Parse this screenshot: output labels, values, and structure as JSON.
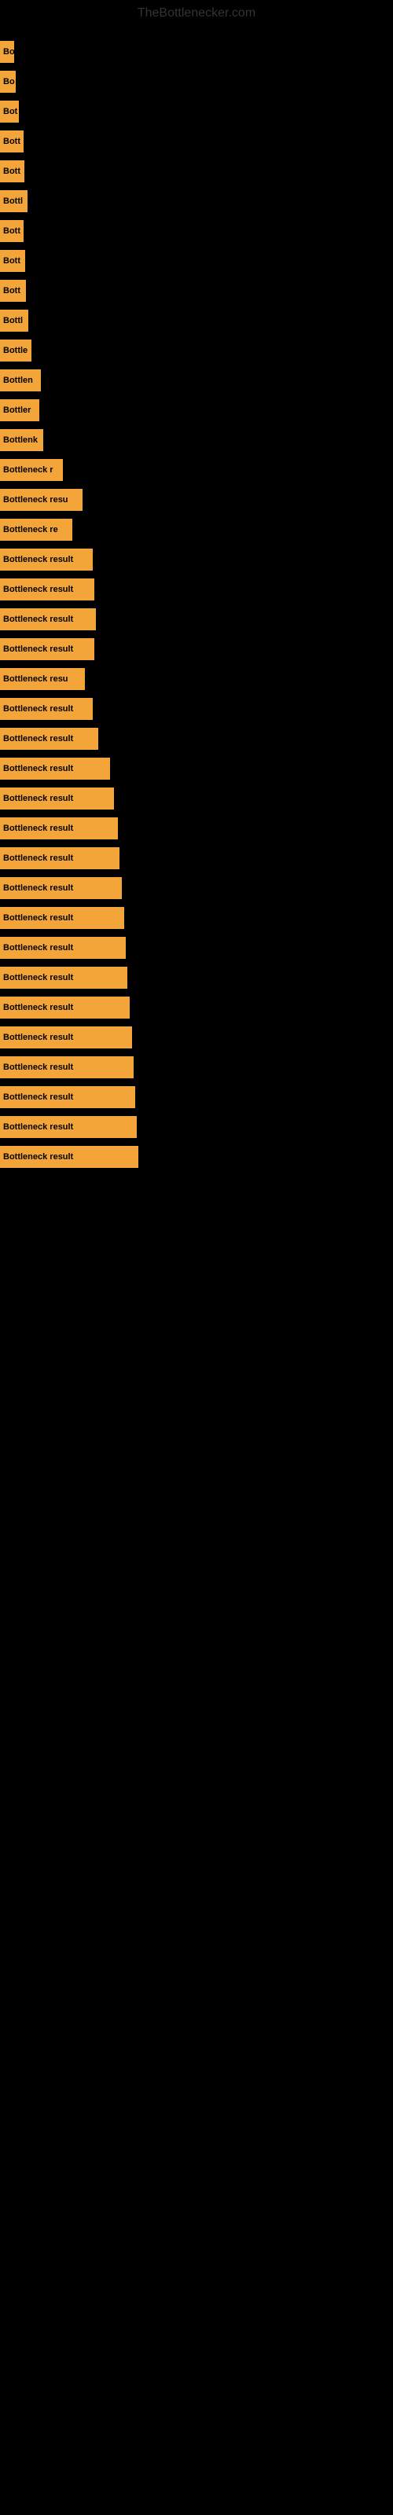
{
  "site": {
    "title": "TheBottlenecker.com"
  },
  "bars": [
    {
      "id": 1,
      "label": "Bo",
      "width": 18
    },
    {
      "id": 2,
      "label": "Bo",
      "width": 20
    },
    {
      "id": 3,
      "label": "Bot",
      "width": 24
    },
    {
      "id": 4,
      "label": "Bott",
      "width": 30
    },
    {
      "id": 5,
      "label": "Bott",
      "width": 31
    },
    {
      "id": 6,
      "label": "Bottl",
      "width": 35
    },
    {
      "id": 7,
      "label": "Bott",
      "width": 30
    },
    {
      "id": 8,
      "label": "Bott",
      "width": 32
    },
    {
      "id": 9,
      "label": "Bott",
      "width": 33
    },
    {
      "id": 10,
      "label": "Bottl",
      "width": 36
    },
    {
      "id": 11,
      "label": "Bottle",
      "width": 40
    },
    {
      "id": 12,
      "label": "Bottlen",
      "width": 52
    },
    {
      "id": 13,
      "label": "Bottler",
      "width": 50
    },
    {
      "id": 14,
      "label": "Bottlenk",
      "width": 55
    },
    {
      "id": 15,
      "label": "Bottleneck r",
      "width": 80
    },
    {
      "id": 16,
      "label": "Bottleneck resu",
      "width": 105
    },
    {
      "id": 17,
      "label": "Bottleneck re",
      "width": 92
    },
    {
      "id": 18,
      "label": "Bottleneck result",
      "width": 118
    },
    {
      "id": 19,
      "label": "Bottleneck result",
      "width": 120
    },
    {
      "id": 20,
      "label": "Bottleneck result",
      "width": 122
    },
    {
      "id": 21,
      "label": "Bottleneck result",
      "width": 120
    },
    {
      "id": 22,
      "label": "Bottleneck resu",
      "width": 108
    },
    {
      "id": 23,
      "label": "Bottleneck result",
      "width": 118
    },
    {
      "id": 24,
      "label": "Bottleneck result",
      "width": 125
    },
    {
      "id": 25,
      "label": "Bottleneck result",
      "width": 140
    },
    {
      "id": 26,
      "label": "Bottleneck result",
      "width": 145
    },
    {
      "id": 27,
      "label": "Bottleneck result",
      "width": 150
    },
    {
      "id": 28,
      "label": "Bottleneck result",
      "width": 152
    },
    {
      "id": 29,
      "label": "Bottleneck result",
      "width": 155
    },
    {
      "id": 30,
      "label": "Bottleneck result",
      "width": 158
    },
    {
      "id": 31,
      "label": "Bottleneck result",
      "width": 160
    },
    {
      "id": 32,
      "label": "Bottleneck result",
      "width": 162
    },
    {
      "id": 33,
      "label": "Bottleneck result",
      "width": 165
    },
    {
      "id": 34,
      "label": "Bottleneck result",
      "width": 168
    },
    {
      "id": 35,
      "label": "Bottleneck result",
      "width": 170
    },
    {
      "id": 36,
      "label": "Bottleneck result",
      "width": 172
    },
    {
      "id": 37,
      "label": "Bottleneck result",
      "width": 174
    },
    {
      "id": 38,
      "label": "Bottleneck result",
      "width": 176
    }
  ]
}
